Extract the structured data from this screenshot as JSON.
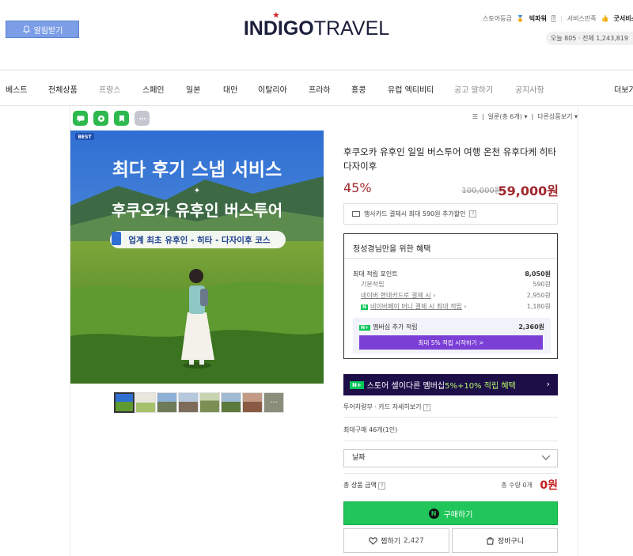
{
  "header": {
    "alarm_label": "알림받기",
    "logo_bold": "INDIGO",
    "logo_light": "TRAVEL",
    "store_grade_label": "스토어등급",
    "store_grade_value": "빅파워",
    "service_label": "서비스만족",
    "service_value": "굿서비스",
    "visitors": "오늘 805 · 전체 1,243,819"
  },
  "nav": {
    "items": [
      "베스트",
      "전체상품",
      "프랑스",
      "스페인",
      "일본",
      "대만",
      "이탈리아",
      "프라하",
      "홍콩",
      "유럽 엑티비티",
      "공고 알하기",
      "공지사항",
      "더보기"
    ]
  },
  "sort": {
    "sep": "☰",
    "view_label": "일룬(총 6개)",
    "other_label": "다른상품보기"
  },
  "image": {
    "best_badge": "BEST",
    "headline1": "최다 후기 스냅 서비스",
    "headline2": "후쿠오카 유후인 버스투어",
    "tagline": "업계 최초 유후인 - 히타 - 다자이후 코스"
  },
  "product": {
    "title": "후쿠오카 유후인 일일 버스투어 여행 온천 유후다케 히타 다자이후",
    "discount": "45%",
    "original_price": "100,000원",
    "sale_price": "59,000원",
    "card_notice": "행사카드 결제시 최대 590원 추가할인"
  },
  "benefit": {
    "title": "정성경님만을 위한 혜택",
    "max_point_label": "최대 적립 포인트",
    "max_point_value": "8,050원",
    "rows": [
      {
        "label": "기본적립",
        "value": "590원"
      },
      {
        "label": "네이버 현대카드로 결제 시",
        "value": "2,950원"
      },
      {
        "label": "네이버페이 머니 결제 시 최대 적립",
        "value": "1,180원"
      }
    ],
    "npay_badge": "N",
    "member_label": "멤버십 추가 적립",
    "member_value": "2,360원",
    "member_badge": "N+",
    "member_btn": "최대 5% 적립 시작하기 >"
  },
  "banner": {
    "badge": "N+",
    "text_pre": "스토어 셀이다른 멤버십 ",
    "text_hl": "5%+10% 적립 혜택",
    "arrow": "›"
  },
  "shipping": {
    "delivery_label": "투어차량부 · 카드 자세히보기",
    "max_purchase": "최대구매 46개(1인)",
    "select_placeholder": "날짜",
    "total_label": "총 상품 금액",
    "total_qty": "총 수량 0개",
    "total_price": "0원"
  },
  "buttons": {
    "buy": "구매하기",
    "buy_logo": "N",
    "wish": "찜하기",
    "wish_count": "2,427",
    "cart": "장바구니"
  },
  "colors": {
    "accent_red": "#a0282d",
    "buy_green": "#20c65a",
    "member_purple": "#7b3fd6",
    "banner_navy": "#1d0e48"
  }
}
